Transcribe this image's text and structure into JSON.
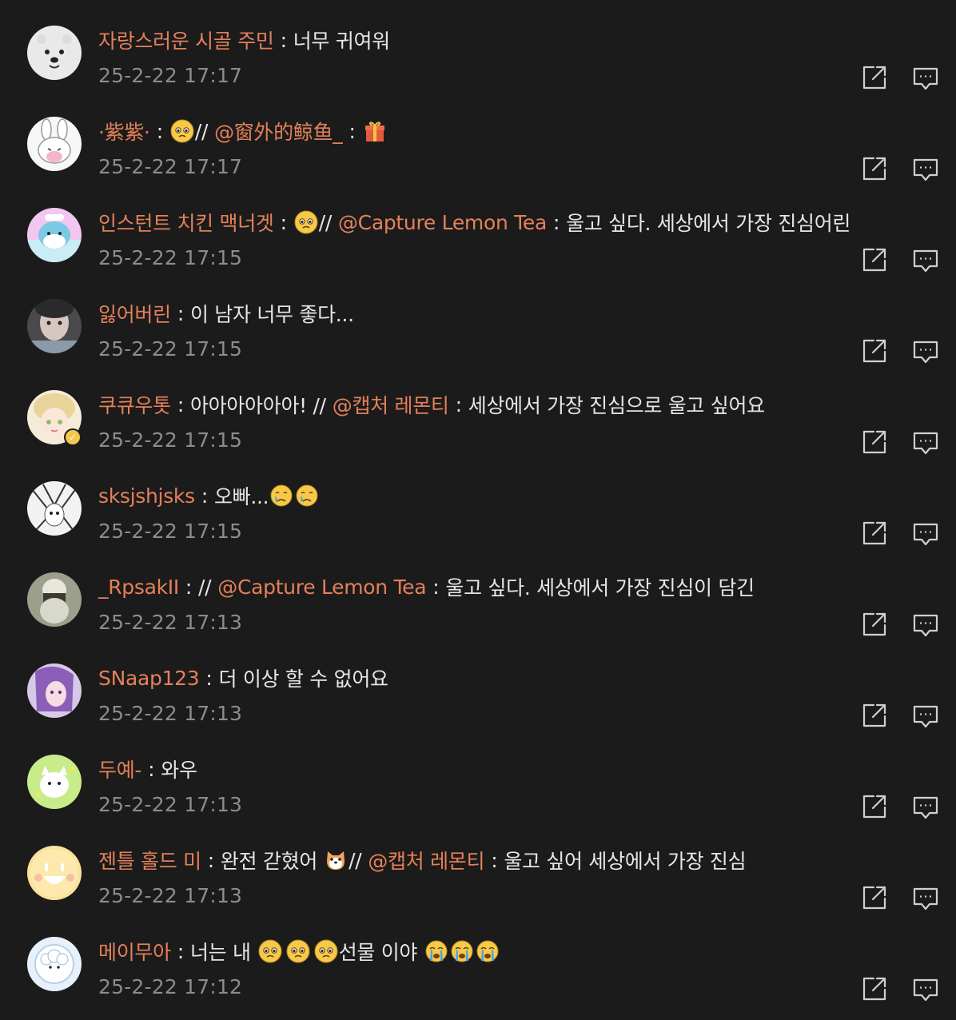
{
  "comments": [
    {
      "user": "자랑스러운 시골 주민",
      "text": "너무 귀여워",
      "time": "25-2-22 17:17",
      "avatar": "polar-bear-avatar"
    },
    {
      "user": "·紫紫·",
      "mention": "@窗外的鲸鱼_",
      "time": "25-2-22 17:17",
      "avatar": "bunny-avatar"
    },
    {
      "user": "인스턴트 치킨 맥너겟",
      "mention": "@Capture Lemon Tea",
      "text": "울고 싶다. 세상에서 가장 진심어린",
      "time": "25-2-22 17:15",
      "avatar": "pastel-whale-avatar"
    },
    {
      "user": "잃어버린",
      "text": "이 남자 너무 좋다...",
      "time": "25-2-22 17:15",
      "avatar": "photo-avatar"
    },
    {
      "user": "쿠큐우톳",
      "text": "아아아아아아! //",
      "mention": "@캡처 레몬티",
      "text2": "세상에서 가장 진심으로 울고 싶어요",
      "time": "25-2-22 17:15",
      "avatar": "anime-girl-avatar"
    },
    {
      "user": "sksjshjsks",
      "text": "오빠...",
      "time": "25-2-22 17:15",
      "avatar": "manga-avatar"
    },
    {
      "user": "_RpsakII",
      "text": "//",
      "mention": "@Capture Lemon Tea",
      "text2": "울고 싶다. 세상에서 가장 진심이 담긴",
      "time": "25-2-22 17:13",
      "avatar": "figure-avatar"
    },
    {
      "user": "SNaap123",
      "text": "더 이상 할 수 없어요",
      "time": "25-2-22 17:13",
      "avatar": "purple-hair-avatar"
    },
    {
      "user": "두예-",
      "text": "와우",
      "time": "25-2-22 17:13",
      "avatar": "cat-cartoon-avatar"
    },
    {
      "user": "젠틀 홀드 미",
      "text": "완전 갇혔어",
      "mention": "@캡처 레몬티",
      "text2": "울고 싶어 세상에서 가장 진심",
      "time": "25-2-22 17:13",
      "avatar": "smiley-avatar"
    },
    {
      "user": "메이무아",
      "text": "너는 내",
      "text2": "선물 이야",
      "time": "25-2-22 17:12",
      "avatar": "cloud-sheep-avatar"
    }
  ],
  "icons": {
    "share": "share-icon",
    "reply": "reply-icon"
  },
  "colors": {
    "background": "#1b1b1b",
    "username": "#e4805a",
    "text": "#e6e6e6",
    "time": "#8c8c8c",
    "icon": "#cfcfcf"
  }
}
